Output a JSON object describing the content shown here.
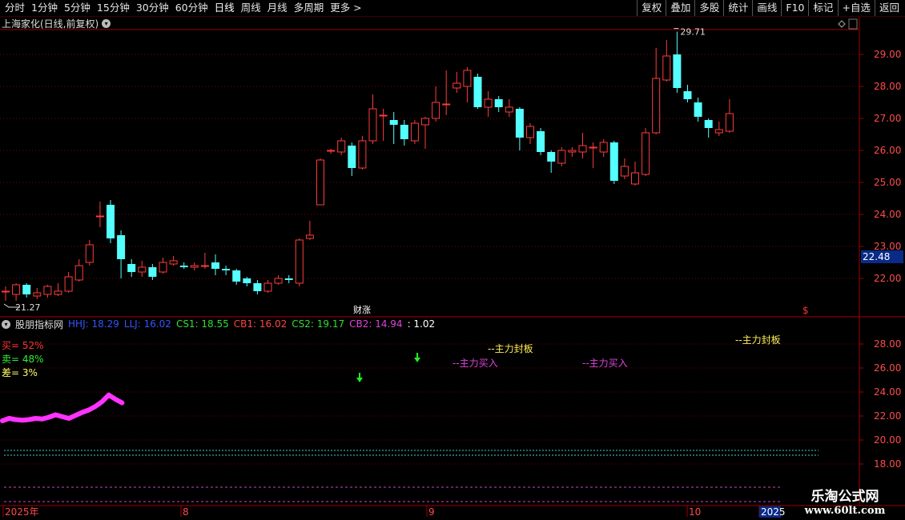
{
  "toolbar": {
    "left_tabs": [
      "分时",
      "1分钟",
      "5分钟",
      "15分钟",
      "30分钟",
      "60分钟",
      "日线",
      "周线",
      "月线",
      "多周期",
      "更多 >"
    ],
    "active_tab": "日线",
    "right_buttons": [
      "复权",
      "叠加",
      "多股",
      "统计",
      "画线",
      "F10",
      "标记",
      "+自选",
      "返回"
    ]
  },
  "main": {
    "title": "上海家化(日线,前复权)",
    "price_labels": [
      "29.00",
      "28.00",
      "27.00",
      "26.00",
      "25.00",
      "24.00",
      "23.00",
      "22.00"
    ],
    "current_price": "22.48",
    "high_marker": "29.71",
    "low_marker": "21.27",
    "event_label": "财涨",
    "event_marker": "$"
  },
  "indicator": {
    "name": "股朋指标网",
    "legend": [
      {
        "text": "HHJ: 18.29",
        "color": "#3355ff"
      },
      {
        "text": "LLJ: 16.02",
        "color": "#3355ff"
      },
      {
        "text": "CS1: 18.55",
        "color": "#33dd33"
      },
      {
        "text": "CB1: 16.02",
        "color": "#ff4444"
      },
      {
        "text": "CS2: 19.17",
        "color": "#33dd33"
      },
      {
        "text": "CB2: 14.94",
        "color": "#dd44dd"
      },
      {
        "text": ": 1.02",
        "color": "#ffffff"
      }
    ],
    "stats": [
      {
        "text": "买= 52%",
        "color": "#ff3333"
      },
      {
        "text": "卖= 48%",
        "color": "#33ee33"
      },
      {
        "text": "差= 3%",
        "color": "#ffff66"
      }
    ],
    "y_labels": [
      "28.00",
      "26.00",
      "24.00",
      "22.00",
      "20.00",
      "18.00"
    ],
    "annotations": [
      {
        "text": "--主力封板",
        "color": "#ffee55"
      },
      {
        "text": "--主力买入",
        "color": "#dd44dd"
      },
      {
        "text": "--主力买入",
        "color": "#dd44dd"
      },
      {
        "text": "--主力封板",
        "color": "#ffee55"
      }
    ]
  },
  "time_axis": [
    "2025年",
    "8",
    "9",
    "10",
    "2025"
  ],
  "watermark": {
    "line1": "乐淘公式网",
    "line2": "www.60lt.com"
  },
  "colors": {
    "up": "#ff3b3b",
    "down": "#54ffff",
    "grid": "#7a0000",
    "axis": "#a00000"
  },
  "candles": [
    {
      "o": 21.6,
      "c": 21.6,
      "h": 21.75,
      "l": 21.3
    },
    {
      "o": 21.5,
      "c": 21.8,
      "h": 21.85,
      "l": 21.3
    },
    {
      "o": 21.8,
      "c": 21.5,
      "h": 21.85,
      "l": 21.4
    },
    {
      "o": 21.45,
      "c": 21.55,
      "h": 21.7,
      "l": 21.35
    },
    {
      "o": 21.5,
      "c": 21.75,
      "h": 21.8,
      "l": 21.4
    },
    {
      "o": 21.5,
      "c": 21.6,
      "h": 21.85,
      "l": 21.45
    },
    {
      "o": 21.6,
      "c": 22.05,
      "h": 22.2,
      "l": 21.55
    },
    {
      "o": 21.95,
      "c": 22.4,
      "h": 22.6,
      "l": 21.9
    },
    {
      "o": 22.5,
      "c": 23.05,
      "h": 23.2,
      "l": 22.4
    },
    {
      "o": 23.95,
      "c": 23.95,
      "h": 24.4,
      "l": 23.6
    },
    {
      "o": 24.3,
      "c": 23.25,
      "h": 24.45,
      "l": 23.1
    },
    {
      "o": 23.35,
      "c": 22.6,
      "h": 23.5,
      "l": 22.0
    },
    {
      "o": 22.45,
      "c": 22.2,
      "h": 22.6,
      "l": 22.05
    },
    {
      "o": 22.2,
      "c": 22.35,
      "h": 22.55,
      "l": 22.05
    },
    {
      "o": 22.35,
      "c": 22.05,
      "h": 22.45,
      "l": 21.95
    },
    {
      "o": 22.2,
      "c": 22.5,
      "h": 22.65,
      "l": 22.15
    },
    {
      "o": 22.45,
      "c": 22.55,
      "h": 22.7,
      "l": 22.4
    },
    {
      "o": 22.4,
      "c": 22.35,
      "h": 22.5,
      "l": 22.3
    },
    {
      "o": 22.35,
      "c": 22.4,
      "h": 22.5,
      "l": 22.25
    },
    {
      "o": 22.4,
      "c": 22.4,
      "h": 22.8,
      "l": 22.3
    },
    {
      "o": 22.5,
      "c": 22.3,
      "h": 22.75,
      "l": 22.1
    },
    {
      "o": 22.3,
      "c": 22.25,
      "h": 22.4,
      "l": 22.1
    },
    {
      "o": 22.25,
      "c": 21.9,
      "h": 22.3,
      "l": 21.8
    },
    {
      "o": 22.0,
      "c": 21.85,
      "h": 22.05,
      "l": 21.75
    },
    {
      "o": 21.85,
      "c": 21.6,
      "h": 21.95,
      "l": 21.5
    },
    {
      "o": 21.6,
      "c": 21.85,
      "h": 21.95,
      "l": 21.55
    },
    {
      "o": 21.85,
      "c": 22.0,
      "h": 22.1,
      "l": 21.8
    },
    {
      "o": 22.0,
      "c": 21.95,
      "h": 22.1,
      "l": 21.85
    },
    {
      "o": 21.85,
      "c": 23.2,
      "h": 23.25,
      "l": 21.75
    },
    {
      "o": 23.25,
      "c": 23.35,
      "h": 23.8,
      "l": 23.2
    },
    {
      "o": 24.3,
      "c": 25.7,
      "h": 25.75,
      "l": 24.3
    },
    {
      "o": 26.0,
      "c": 26.0,
      "h": 26.05,
      "l": 25.9
    },
    {
      "o": 25.95,
      "c": 26.3,
      "h": 26.4,
      "l": 25.85
    },
    {
      "o": 26.15,
      "c": 25.45,
      "h": 26.25,
      "l": 25.2
    },
    {
      "o": 25.45,
      "c": 26.3,
      "h": 26.45,
      "l": 25.4
    },
    {
      "o": 26.3,
      "c": 27.3,
      "h": 27.75,
      "l": 26.2
    },
    {
      "o": 27.1,
      "c": 27.1,
      "h": 27.3,
      "l": 26.3
    },
    {
      "o": 26.95,
      "c": 26.8,
      "h": 27.2,
      "l": 26.2
    },
    {
      "o": 26.8,
      "c": 26.35,
      "h": 26.95,
      "l": 26.15
    },
    {
      "o": 26.3,
      "c": 26.85,
      "h": 26.95,
      "l": 26.2
    },
    {
      "o": 26.8,
      "c": 27.0,
      "h": 27.05,
      "l": 26.05
    },
    {
      "o": 27.0,
      "c": 27.5,
      "h": 28.0,
      "l": 26.9
    },
    {
      "o": 27.45,
      "c": 27.45,
      "h": 28.5,
      "l": 27.1
    },
    {
      "o": 27.95,
      "c": 28.1,
      "h": 28.45,
      "l": 27.8
    },
    {
      "o": 28.0,
      "c": 28.5,
      "h": 28.6,
      "l": 27.5
    },
    {
      "o": 28.3,
      "c": 27.35,
      "h": 28.4,
      "l": 27.3
    },
    {
      "o": 27.35,
      "c": 27.6,
      "h": 27.85,
      "l": 27.05
    },
    {
      "o": 27.6,
      "c": 27.35,
      "h": 27.7,
      "l": 27.2
    },
    {
      "o": 27.2,
      "c": 27.35,
      "h": 27.6,
      "l": 27.05
    },
    {
      "o": 27.3,
      "c": 26.4,
      "h": 27.35,
      "l": 26.0
    },
    {
      "o": 26.4,
      "c": 26.75,
      "h": 26.85,
      "l": 26.2
    },
    {
      "o": 26.6,
      "c": 25.95,
      "h": 26.7,
      "l": 25.85
    },
    {
      "o": 25.95,
      "c": 25.65,
      "h": 26.0,
      "l": 25.3
    },
    {
      "o": 25.6,
      "c": 26.0,
      "h": 26.1,
      "l": 25.5
    },
    {
      "o": 25.95,
      "c": 26.0,
      "h": 26.1,
      "l": 25.8
    },
    {
      "o": 25.95,
      "c": 26.15,
      "h": 26.55,
      "l": 25.75
    },
    {
      "o": 26.1,
      "c": 26.1,
      "h": 26.25,
      "l": 25.45
    },
    {
      "o": 25.95,
      "c": 26.25,
      "h": 26.35,
      "l": 25.8
    },
    {
      "o": 26.25,
      "c": 25.05,
      "h": 26.3,
      "l": 24.95
    },
    {
      "o": 25.2,
      "c": 25.5,
      "h": 25.75,
      "l": 25.1
    },
    {
      "o": 24.95,
      "c": 25.3,
      "h": 25.65,
      "l": 24.9
    },
    {
      "o": 25.25,
      "c": 26.55,
      "h": 26.7,
      "l": 25.2
    },
    {
      "o": 26.55,
      "c": 28.25,
      "h": 29.2,
      "l": 26.5
    },
    {
      "o": 28.2,
      "c": 28.95,
      "h": 29.45,
      "l": 28.15
    },
    {
      "o": 29.0,
      "c": 27.95,
      "h": 29.71,
      "l": 27.8
    },
    {
      "o": 27.85,
      "c": 27.6,
      "h": 28.05,
      "l": 27.5
    },
    {
      "o": 27.5,
      "c": 27.05,
      "h": 27.65,
      "l": 26.9
    },
    {
      "o": 26.95,
      "c": 26.7,
      "h": 27.0,
      "l": 26.4
    },
    {
      "o": 26.55,
      "c": 26.65,
      "h": 26.9,
      "l": 26.45
    },
    {
      "o": 26.6,
      "c": 27.15,
      "h": 27.6,
      "l": 26.55
    }
  ],
  "pink_line": [
    21.6,
    21.8,
    21.7,
    21.65,
    21.7,
    21.8,
    21.75,
    21.9,
    22.1,
    21.95,
    21.8,
    22.05,
    22.3,
    22.5,
    22.8,
    23.2,
    23.75,
    23.4,
    23.1
  ]
}
